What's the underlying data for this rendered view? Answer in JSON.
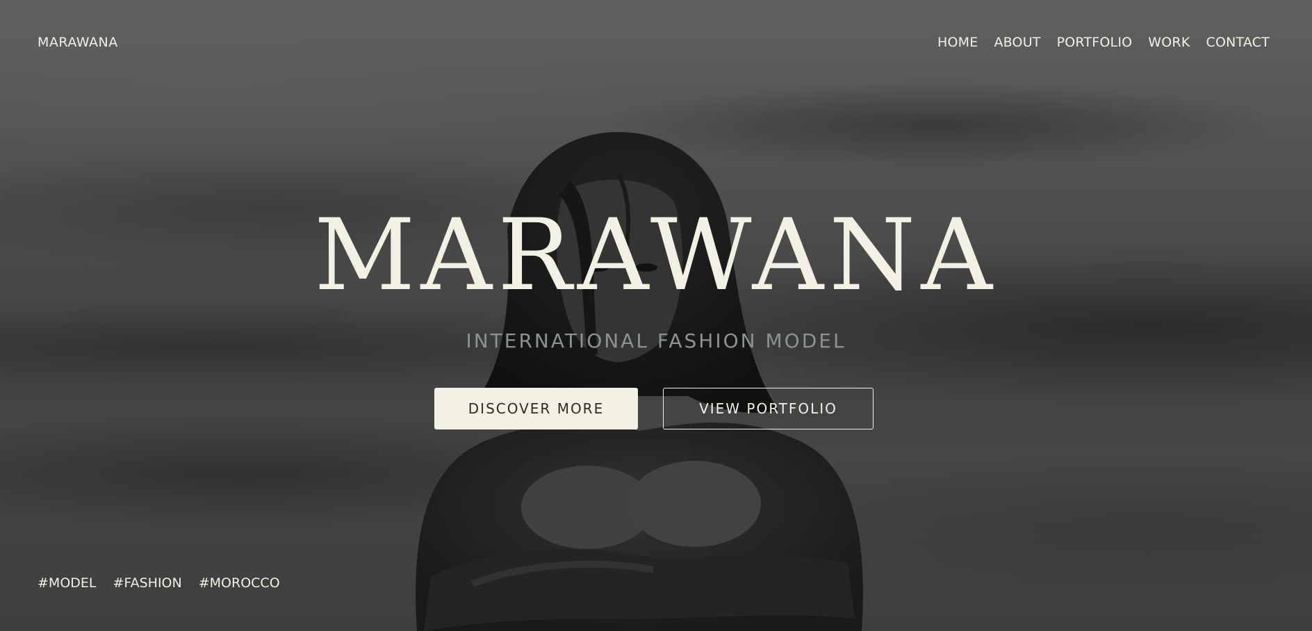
{
  "brand": {
    "logo": "MARAWANA"
  },
  "nav": {
    "items": [
      {
        "label": "HOME"
      },
      {
        "label": "ABOUT"
      },
      {
        "label": "PORTFOLIO"
      },
      {
        "label": "WORK"
      },
      {
        "label": "CONTACT"
      }
    ]
  },
  "hero": {
    "title": "MARAWANA",
    "subtitle": "INTERNATIONAL FASHION MODEL",
    "primary_button": "DISCOVER MORE",
    "secondary_button": "VIEW PORTFOLIO"
  },
  "tags": [
    {
      "label": "#MODEL"
    },
    {
      "label": "#FASHION"
    },
    {
      "label": "#MOROCCO"
    }
  ],
  "colors": {
    "text": "#f2f1e4",
    "subtitle": "#8a9590",
    "button_text_dark": "#2b2b2b",
    "background": "#555555"
  }
}
